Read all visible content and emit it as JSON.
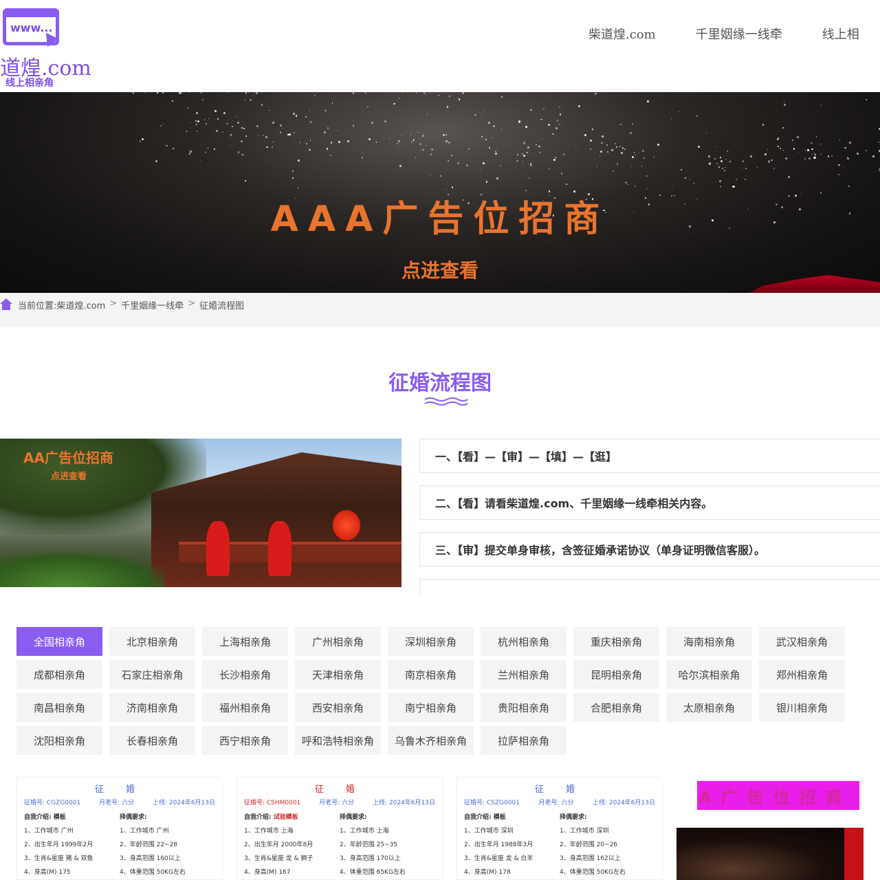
{
  "header": {
    "logo_badge": "www...",
    "logo_title": "道煌.com",
    "logo_subtitle": "线上相亲角",
    "nav": [
      "柴道煌.com",
      "千里姻缘一线牵",
      "线上相"
    ]
  },
  "banner": {
    "title": "AAA广告位招商",
    "link": "点进查看"
  },
  "breadcrumb": {
    "prefix": "当前位置:",
    "items": [
      "柴道煌.com",
      "千里姻缘一线牵",
      "征婚流程图"
    ],
    "separator": ">"
  },
  "section": {
    "title": "征婚流程图"
  },
  "promo": {
    "ad_title": "AA广告位招商",
    "ad_link": "点进查看"
  },
  "steps": [
    "一、【看】—【审】—【填】—【逛】",
    "二、【看】请看柴道煌.com、千里姻缘一线牵相关内容。",
    "三、【审】提交单身审核，含签征婚承诺协议（单身证明微信客服）。",
    ""
  ],
  "cities": [
    "全国相亲角",
    "北京相亲角",
    "上海相亲角",
    "广州相亲角",
    "深圳相亲角",
    "杭州相亲角",
    "重庆相亲角",
    "海南相亲角",
    "武汉相亲角",
    "成都相亲角",
    "石家庄相亲角",
    "长沙相亲角",
    "天津相亲角",
    "南京相亲角",
    "兰州相亲角",
    "昆明相亲角",
    "哈尔滨相亲角",
    "郑州相亲角",
    "南昌相亲角",
    "济南相亲角",
    "福州相亲角",
    "西安相亲角",
    "南宁相亲角",
    "贵阳相亲角",
    "合肥相亲角",
    "太原相亲角",
    "银川相亲角",
    "沈阳相亲角",
    "长春相亲角",
    "西宁相亲角",
    "呼和浩特相亲角",
    "乌鲁木齐相亲角",
    "拉萨相亲角"
  ],
  "active_city_index": 0,
  "cards": [
    {
      "title": "征 婚",
      "id": "征婚号: CGZG0001",
      "author": "月老号: 六分",
      "date": "上线: 2024年6月13日",
      "intro_label": "自我介绍:",
      "intro": "模板",
      "req_label": "择偶要求:",
      "left": [
        "1、工作城市 广州",
        "2、出生年月 1999年2月",
        "3、生肖&星座 猪 & 双鱼",
        "4、身高(M) 175"
      ],
      "right": [
        "1、工作城市 广州",
        "2、年龄范围 22~28",
        "3、身高范围 160以上",
        "4、体重范围 50KG左右"
      ]
    },
    {
      "title": "征 婚",
      "id": "征婚号: CSHM0001",
      "author": "月老号: 六分",
      "date": "上线: 2024年6月13日",
      "intro_label": "自我介绍:",
      "intro": "试验模板",
      "req_label": "择偶要求:",
      "left": [
        "1、工作城市 上海",
        "2、出生年月 2000年8月",
        "3、生肖&星座 龙 & 狮子",
        "4、身高(M) 167"
      ],
      "right": [
        "1、工作城市 上海",
        "2、年龄范围 25~35",
        "3、身高范围 170以上",
        "4、体重范围 65KG左右"
      ]
    },
    {
      "title": "征 婚",
      "id": "征婚号: CSZG0001",
      "author": "月老号: 六分",
      "date": "上线: 2024年6月13日",
      "intro_label": "自我介绍:",
      "intro": "模板",
      "req_label": "择偶要求:",
      "left": [
        "1、工作城市 深圳",
        "2、出生年月 1988年3月",
        "3、生肖&星座 龙 & 白羊",
        "4、身高(M) 178"
      ],
      "right": [
        "1、工作城市 深圳",
        "2、年龄范围 20~26",
        "3、身高范围 162以上",
        "4、体重范围 50KG左右"
      ]
    }
  ],
  "side_ad": {
    "title": "A广告位招商"
  },
  "colors": {
    "accent": "#8a5cf0",
    "banner_text": "#e9742e",
    "ad_magenta": "#e91ee9"
  }
}
